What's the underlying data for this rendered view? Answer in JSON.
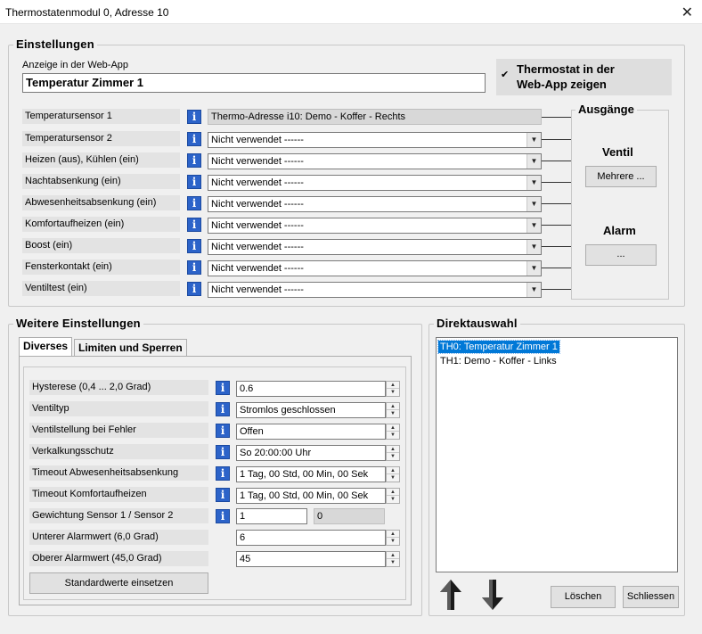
{
  "window": {
    "title": "Thermostatenmodul 0, Adresse 10",
    "close_symbol": "✕"
  },
  "einstellungen": {
    "title": "Einstellungen",
    "webapp_label": "Anzeige in der Web-App",
    "webapp_value": "Temperatur Zimmer 1",
    "show_checkbox": {
      "checked": true,
      "mark": "✔",
      "label_line1": "Thermostat in der",
      "label_line2": "Web-App zeigen"
    },
    "info_glyph": "i",
    "sensor1": {
      "label": "Temperatursensor 1",
      "value": "Thermo-Adresse i10: Demo - Koffer - Rechts"
    },
    "inputs": [
      {
        "label": "Temperatursensor 2",
        "value": "Nicht verwendet ------"
      },
      {
        "label": "Heizen (aus), Kühlen (ein)",
        "value": "Nicht verwendet ------"
      },
      {
        "label": "Nachtabsenkung (ein)",
        "value": "Nicht verwendet ------"
      },
      {
        "label": "Abwesenheitsabsenkung (ein)",
        "value": "Nicht verwendet ------"
      },
      {
        "label": "Komfortaufheizen (ein)",
        "value": "Nicht verwendet ------"
      },
      {
        "label": "Boost (ein)",
        "value": "Nicht verwendet ------"
      },
      {
        "label": "Fensterkontakt (ein)",
        "value": "Nicht verwendet ------"
      },
      {
        "label": "Ventiltest (ein)",
        "value": "Nicht verwendet ------"
      }
    ],
    "combo_arrow": "▼"
  },
  "ausgaenge": {
    "title": "Ausgänge",
    "ventil_label": "Ventil",
    "ventil_button": "Mehrere ...",
    "alarm_label": "Alarm",
    "alarm_button": "..."
  },
  "weitere": {
    "title": "Weitere Einstellungen",
    "tabs": [
      {
        "label": "Diverses",
        "active": true
      },
      {
        "label": "Limiten und Sperren",
        "active": false
      }
    ],
    "spin_up": "▲",
    "spin_down": "▼",
    "rows": [
      {
        "label": "Hysterese (0,4 ... 2,0 Grad)",
        "value": "0.6",
        "info": true
      },
      {
        "label": "Ventiltyp",
        "value": "Stromlos geschlossen",
        "info": true
      },
      {
        "label": "Ventilstellung bei Fehler",
        "value": "Offen",
        "info": true
      },
      {
        "label": "Verkalkungsschutz",
        "value": "So 20:00:00 Uhr",
        "info": true
      },
      {
        "label": "Timeout Abwesenheitsabsenkung",
        "value": "1 Tag, 00 Std, 00 Min, 00 Sek",
        "info": true
      },
      {
        "label": "Timeout Komfortaufheizen",
        "value": "1 Tag, 00 Std, 00 Min, 00 Sek",
        "info": true
      }
    ],
    "gewichtung": {
      "label": "Gewichtung Sensor 1 / Sensor 2",
      "value1": "1",
      "value2": "0"
    },
    "unterer": {
      "label": "Unterer Alarmwert (6,0 Grad)",
      "value": "6"
    },
    "oberer": {
      "label": "Oberer Alarmwert (45,0 Grad)",
      "value": "45"
    },
    "defaults_button": "Standardwerte einsetzen"
  },
  "direktauswahl": {
    "title": "Direktauswahl",
    "items": [
      {
        "label": "TH0: Temperatur Zimmer 1",
        "selected": true
      },
      {
        "label": "TH1: Demo - Koffer - Links",
        "selected": false
      }
    ],
    "delete_button": "Löschen",
    "close_button": "Schliessen"
  }
}
